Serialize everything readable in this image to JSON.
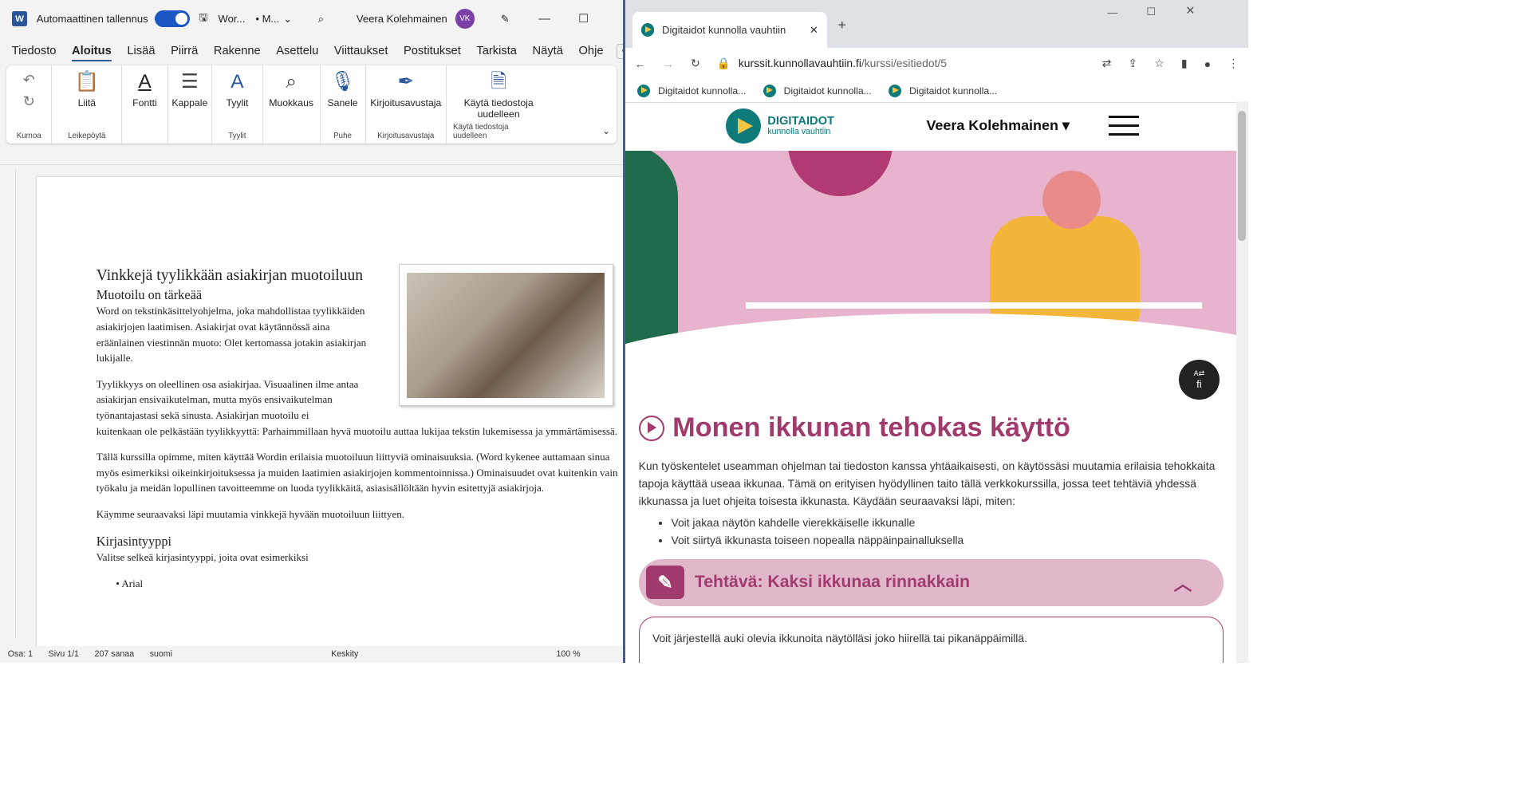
{
  "word": {
    "autosave_label": "Automaattinen tallennus",
    "doc_name": "Wor...",
    "extra_title": "• M...",
    "user_name": "Veera Kolehmainen",
    "user_initials": "VK",
    "menu": [
      "Tiedosto",
      "Aloitus",
      "Lisää",
      "Piirrä",
      "Rakenne",
      "Asettelu",
      "Viittaukset",
      "Postitukset",
      "Tarkista",
      "Näytä",
      "Ohje"
    ],
    "ribbon": {
      "paste": "Liitä",
      "font": "Fontti",
      "paragraph": "Kappale",
      "styles": "Tyylit",
      "editing": "Muokkaus",
      "dictate": "Sanele",
      "editor": "Kirjoitusavustaja",
      "reuse": "Käytä tiedostoja uudelleen",
      "g_undo": "Kumoa",
      "g_clipboard": "Leikepöytä",
      "g_styles": "Tyylit",
      "g_voice": "Puhe",
      "g_editor": "Kirjoitusavustaja",
      "g_reuse": "Käytä tiedostoja uudelleen"
    },
    "doc": {
      "title": "Vinkkejä tyylikkään asiakirjan muotoiluun",
      "subtitle": "Muotoilu on tärkeää",
      "p1": "Word on tekstinkäsittelyohjelma, joka mahdollistaa tyylikkäiden asiakirjojen laatimisen. Asiakirjat ovat käytännössä aina eräänlainen viestinnän muoto: Olet kertomassa jotakin asiakirjan lukijalle.",
      "p2a": "Tyylikkyys on oleellinen osa asiakirjaa. Visuaalinen ilme antaa asiakirjan ensivaikutelman, mutta myös ensivaikutelman työnantajastasi sekä sinusta. Asiakirjan muotoilu ei",
      "p2b": "kuitenkaan ole pelkästään tyylikkyyttä: Parhaimmillaan hyvä muotoilu auttaa lukijaa tekstin lukemisessa ja ymmärtämisessä.",
      "p3": "Tällä kurssilla opimme, miten käyttää Wordin erilaisia muotoiluun liittyviä ominaisuuksia. (Word kykenee auttamaan sinua myös esimerkiksi oikeinkirjoituksessa ja muiden laatimien asiakirjojen kommentoinnissa.) Ominaisuudet ovat kuitenkin vain työkalu ja meidän lopullinen tavoitteemme on luoda tyylikkäitä, asiasisällöltään hyvin esitettyjä asiakirjoja.",
      "p4": "Käymme seuraavaksi läpi muutamia vinkkejä hyvään muotoiluun liittyen.",
      "h_font": "Kirjasintyyppi",
      "p5": "Valitse selkeä kirjasintyyppi, joita ovat esimerkiksi",
      "bullet1": "Arial"
    },
    "status": {
      "section": "Osa: 1",
      "page": "Sivu 1/1",
      "words": "207 sanaa",
      "lang": "suomi",
      "focus": "Keskity",
      "zoom": "100 %"
    }
  },
  "chrome": {
    "tab_title": "Digitaidot kunnolla vauhtiin",
    "url_host": "kurssit.kunnollavauhtiin.fi",
    "url_path": "/kurssi/esitiedot/5",
    "bookmarks": [
      "Digitaidot kunnolla...",
      "Digitaidot kunnolla...",
      "Digitaidot kunnolla..."
    ]
  },
  "site": {
    "brand": "DIGITAIDOT",
    "brand_sub": "kunnolla vauhtiin",
    "user": "Veera Kolehmainen",
    "lang_badge": "fi",
    "heading": "Monen ikkunan tehokas käyttö",
    "intro": "Kun työskentelet useamman ohjelman tai tiedoston kanssa yhtäaikaisesti, on käytössäsi muutamia erilaisia tehokkaita tapoja käyttää useaa ikkunaa. Tämä on erityisen hyödyllinen taito tällä verkkokurssilla, jossa teet tehtäviä yhdessä ikkunassa ja luet ohjeita toisesta ikkunasta. Käydään seuraavaksi läpi, miten:",
    "bullets": [
      "Voit jakaa näytön kahdelle vierekkäiselle ikkunalle",
      "Voit siirtyä ikkunasta toiseen nopealla näppäinpainalluksella"
    ],
    "task_title": "Tehtävä: Kaksi ikkunaa rinnakkain",
    "task_text": "Voit järjestellä auki olevia ikkunoita näytölläsi joko hiirellä tai pikanäppäimillä."
  }
}
